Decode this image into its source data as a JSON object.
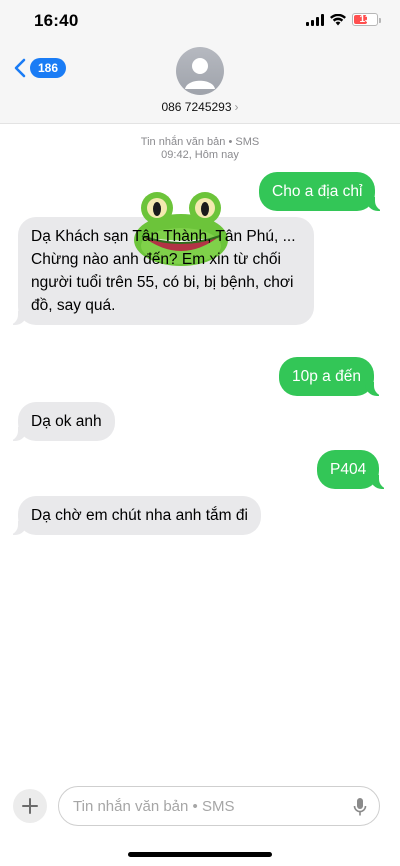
{
  "status_bar": {
    "time": "16:40",
    "battery": "13"
  },
  "header": {
    "back_count": "186",
    "contact": "086 7245293",
    "contact_chevron": "›"
  },
  "thread": {
    "meta_line1": "Tin nhắn văn bản • SMS",
    "meta_line2": "09:42, Hôm nay",
    "messages": [
      {
        "from": "me",
        "text": "Cho a địa chỉ"
      },
      {
        "from": "them",
        "text": "Dạ Khách sạn Tân Thành, Tân Phú, ... Chừng nào anh đến? Em xin từ chối người tuổi trên 55, có bi, bị bệnh, chơi đồ, say quá."
      },
      {
        "from": "me",
        "text": "10p a đến"
      },
      {
        "from": "them",
        "text": "Dạ ok anh"
      },
      {
        "from": "me",
        "text": "P404"
      },
      {
        "from": "them",
        "text": "Dạ chờ em chút nha anh tắm đi"
      }
    ]
  },
  "composer": {
    "placeholder": "Tin nhắn văn bản • SMS"
  },
  "icons": {
    "back": "chevron-left-icon",
    "avatar": "person-icon",
    "plus": "plus-icon",
    "mic": "microphone-icon",
    "signal": "cellular-signal-icon",
    "wifi": "wifi-icon",
    "battery": "battery-icon",
    "sticker": "frog-sticker"
  },
  "colors": {
    "outgoing": "#33c657",
    "incoming": "#e9e9eb",
    "accent": "#1a7cf5",
    "battery_low": "#ff4f4f"
  }
}
